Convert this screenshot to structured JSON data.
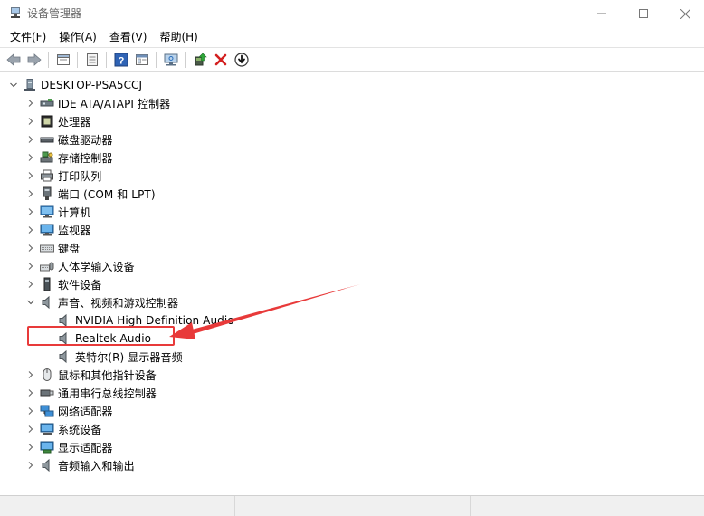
{
  "window": {
    "title": "设备管理器"
  },
  "menu": [
    {
      "label": "文件(F)"
    },
    {
      "label": "操作(A)"
    },
    {
      "label": "查看(V)"
    },
    {
      "label": "帮助(H)"
    }
  ],
  "toolbar": [
    {
      "icon": "back-arrow-icon"
    },
    {
      "icon": "forward-arrow-icon"
    },
    {
      "icon": "properties-icon"
    },
    {
      "icon": "list-view-icon"
    },
    {
      "icon": "help-icon"
    },
    {
      "icon": "details-icon"
    },
    {
      "icon": "scan-hardware-icon"
    },
    {
      "icon": "update-driver-icon"
    },
    {
      "icon": "uninstall-x-icon"
    },
    {
      "icon": "download-circle-icon"
    }
  ],
  "tree": {
    "root": "DESKTOP-PSA5CCJ",
    "categories": [
      {
        "label": "IDE ATA/ATAPI 控制器",
        "icon": "ide-controller-icon"
      },
      {
        "label": "处理器",
        "icon": "processor-icon"
      },
      {
        "label": "磁盘驱动器",
        "icon": "disk-drive-icon"
      },
      {
        "label": "存储控制器",
        "icon": "storage-controller-icon"
      },
      {
        "label": "打印队列",
        "icon": "printer-icon"
      },
      {
        "label": "端口 (COM 和 LPT)",
        "icon": "port-icon"
      },
      {
        "label": "计算机",
        "icon": "computer-icon"
      },
      {
        "label": "监视器",
        "icon": "monitor-icon"
      },
      {
        "label": "键盘",
        "icon": "keyboard-icon"
      },
      {
        "label": "人体学输入设备",
        "icon": "hid-icon"
      },
      {
        "label": "软件设备",
        "icon": "software-device-icon"
      },
      {
        "label": "声音、视频和游戏控制器",
        "icon": "speaker-icon",
        "expanded": true
      },
      {
        "label": "鼠标和其他指针设备",
        "icon": "mouse-icon"
      },
      {
        "label": "通用串行总线控制器",
        "icon": "usb-icon"
      },
      {
        "label": "网络适配器",
        "icon": "network-icon"
      },
      {
        "label": "系统设备",
        "icon": "system-device-icon"
      },
      {
        "label": "显示适配器",
        "icon": "display-adapter-icon"
      },
      {
        "label": "音频输入和输出",
        "icon": "speaker-icon"
      }
    ],
    "sound_children": [
      {
        "label": "NVIDIA High Definition Audio"
      },
      {
        "label": "Realtek Audio",
        "highlighted": true
      },
      {
        "label": "英特尔(R) 显示器音频"
      }
    ]
  },
  "colors": {
    "annotation_red": "#e83a3a",
    "accent_blue": "#2a6ebb"
  }
}
